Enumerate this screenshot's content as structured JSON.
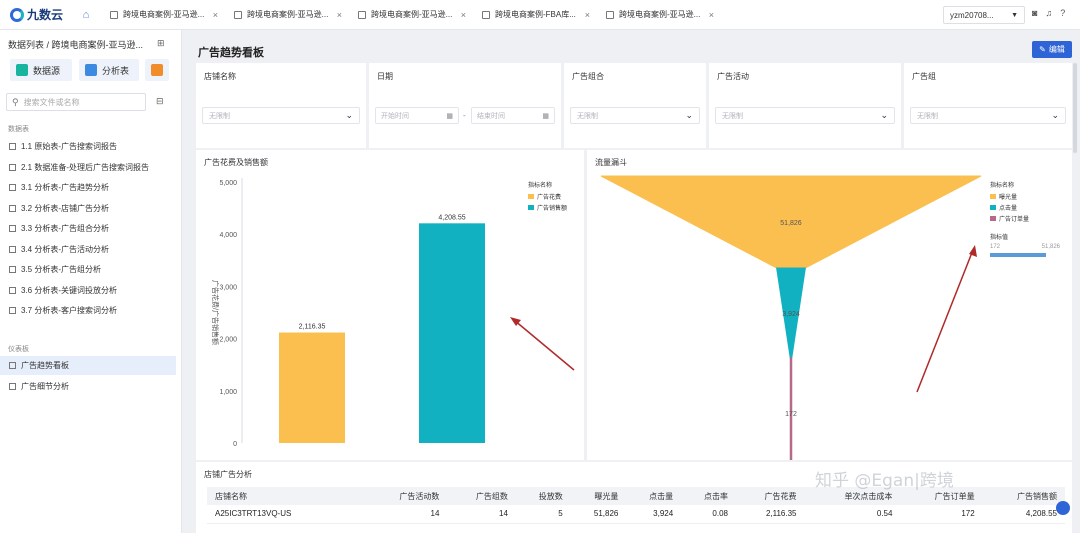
{
  "app": {
    "logo_text": "九数云"
  },
  "tabs": [
    {
      "label": "跨境电商案例-亚马逊..."
    },
    {
      "label": "跨境电商案例-亚马逊..."
    },
    {
      "label": "跨境电商案例-亚马逊..."
    },
    {
      "label": "跨境电商案例-FBA库..."
    },
    {
      "label": "跨境电商案例-亚马逊..."
    }
  ],
  "user": {
    "name": "yzm20708..."
  },
  "sidebar": {
    "breadcrumb": "数据列表 / 跨境电商案例-亚马逊...",
    "buttons": {
      "datasource": "数据源",
      "analysis": "分析表"
    },
    "search_placeholder": "搜索文件或名称",
    "section_data": "数据表",
    "items": [
      {
        "label": "1.1 原始表-广告搜索词报告"
      },
      {
        "label": "2.1 数据准备-处理后广告搜索词报告"
      },
      {
        "label": "3.1 分析表-广告趋势分析"
      },
      {
        "label": "3.2 分析表-店铺广告分析"
      },
      {
        "label": "3.3 分析表-广告组合分析"
      },
      {
        "label": "3.4 分析表-广告活动分析"
      },
      {
        "label": "3.5 分析表-广告组分析"
      },
      {
        "label": "3.6 分析表-关键词投放分析"
      },
      {
        "label": "3.7 分析表-客户搜索词分析"
      }
    ],
    "section_dash": "仪表板",
    "dash_items": [
      {
        "label": "广告趋势看板"
      },
      {
        "label": "广告细节分析"
      }
    ]
  },
  "main": {
    "title": "广告趋势看板",
    "edit_label": "编辑",
    "filters": [
      {
        "label": "店铺名称",
        "placeholder": "无限制"
      },
      {
        "label": "日期",
        "start_placeholder": "开始时间",
        "end_placeholder": "结束时间"
      },
      {
        "label": "广告组合",
        "placeholder": "无限制"
      },
      {
        "label": "广告活动",
        "placeholder": "无限制"
      },
      {
        "label": "广告组",
        "placeholder": "无限制"
      }
    ],
    "bar_panel_title": "广告花费及销售额",
    "funnel_panel_title": "流量漏斗",
    "table_title": "店铺广告分析",
    "table": {
      "headers": [
        "店铺名称",
        "广告活动数",
        "广告组数",
        "投放数",
        "曝光量",
        "点击量",
        "点击率",
        "广告花费",
        "单次点击成本",
        "广告订单量",
        "广告销售额"
      ],
      "rows": [
        [
          "A25IC3TRT13VQ-US",
          "14",
          "14",
          "5",
          "51,826",
          "3,924",
          "0.08",
          "2,116.35",
          "0.54",
          "172",
          "4,208.55"
        ]
      ]
    },
    "watermark": "知乎 @Egan|跨境"
  },
  "chart_data": [
    {
      "type": "bar",
      "categories": [
        "广告花费",
        "广告销售额"
      ],
      "values": [
        2116.35,
        4208.55
      ],
      "value_labels": [
        "2,116.35",
        "4,208.55"
      ],
      "ylabel": "广告花费/广告销售额",
      "ylim": [
        0,
        5000
      ],
      "yticks": [
        "0",
        "1,000",
        "2,000",
        "3,000",
        "4,000",
        "5,000"
      ],
      "legend_title": "指标名称",
      "legend": [
        "广告花费",
        "广告销售额"
      ],
      "colors": [
        "#fbbf50",
        "#11b1c1"
      ],
      "legend_position": "top-right",
      "grid": false
    },
    {
      "type": "funnel",
      "categories": [
        "曝光量",
        "点击量",
        "广告订单量"
      ],
      "values": [
        51826,
        3924,
        172
      ],
      "value_labels": [
        "51,826",
        "3,924",
        "172"
      ],
      "legend_title": "指标名称",
      "legend": [
        "曝光量",
        "点击量",
        "广告订单量"
      ],
      "colors": [
        "#fbbf50",
        "#11b1c1",
        "#b56a8a"
      ],
      "range_title": "指标值",
      "range_min": "172",
      "range_max": "51,826",
      "legend_position": "right"
    }
  ]
}
